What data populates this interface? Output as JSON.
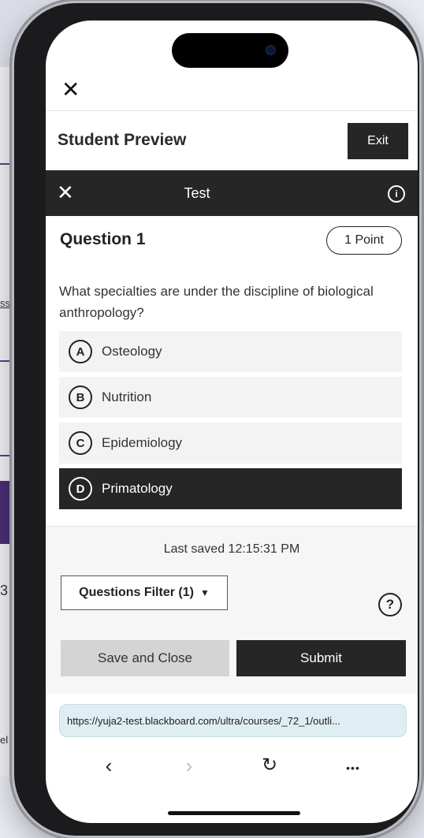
{
  "header": {
    "close_glyph": "✕",
    "title": "Student Preview",
    "exit_label": "Exit"
  },
  "test_bar": {
    "close_glyph": "✕",
    "title": "Test",
    "info_glyph": "i"
  },
  "question": {
    "title": "Question 1",
    "points": "1 Point",
    "text": "What specialties are under the discipline of biological anthropology?",
    "options": [
      {
        "letter": "A",
        "label": "Osteology",
        "selected": false
      },
      {
        "letter": "B",
        "label": "Nutrition",
        "selected": false
      },
      {
        "letter": "C",
        "label": "Epidemiology",
        "selected": false
      },
      {
        "letter": "D",
        "label": "Primatology",
        "selected": true
      }
    ]
  },
  "footer": {
    "last_saved": "Last saved 12:15:31 PM",
    "filter_label": "Questions Filter (1)",
    "filter_caret": "▼",
    "help_glyph": "?",
    "save_close_label": "Save and Close",
    "submit_label": "Submit"
  },
  "browser": {
    "url": "https://yuja2-test.blackboard.com/ultra/courses/_72_1/outli...",
    "back_glyph": "‹",
    "forward_glyph": "›",
    "reload_glyph": "↻",
    "more_glyph": "•••"
  },
  "background_page": {
    "fragments": [
      "ssi",
      "3 .",
      "el"
    ]
  },
  "colors": {
    "dark": "#262626",
    "option_bg": "#f3f3f3",
    "url_bg": "#dfeef2",
    "background_accent": "#4a2e74"
  }
}
